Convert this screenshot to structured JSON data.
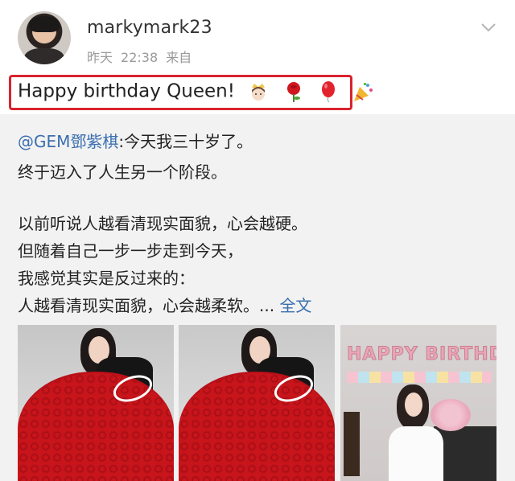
{
  "header": {
    "username": "markymark23",
    "time_day": "昨天",
    "time_clock": "22:38",
    "source": "来自"
  },
  "post": {
    "text": "Happy birthday Queen!",
    "emojis": [
      "princess-emoji",
      "rose-emoji",
      "balloon-emoji",
      "party-popper-emoji"
    ]
  },
  "repost": {
    "mention": "@GEM鄧紫棋",
    "line1": ":今天我三十岁了。",
    "line2": "终于迈入了人生另一个阶段。",
    "line3": "以前听说人越看清现实面貌，心会越硬。",
    "line4": "但随着自己一步一步走到今天，",
    "line5": "我感觉其实是反过来的：",
    "line6": "人越看清现实面貌，心会越柔软。...",
    "full_text_link": "全文",
    "photo3_banner": "HAPPY BIRTHDAY"
  },
  "colors": {
    "link": "#3a6fb0",
    "highlight": "#d9232d",
    "repost_bg": "#f2f2f2"
  }
}
